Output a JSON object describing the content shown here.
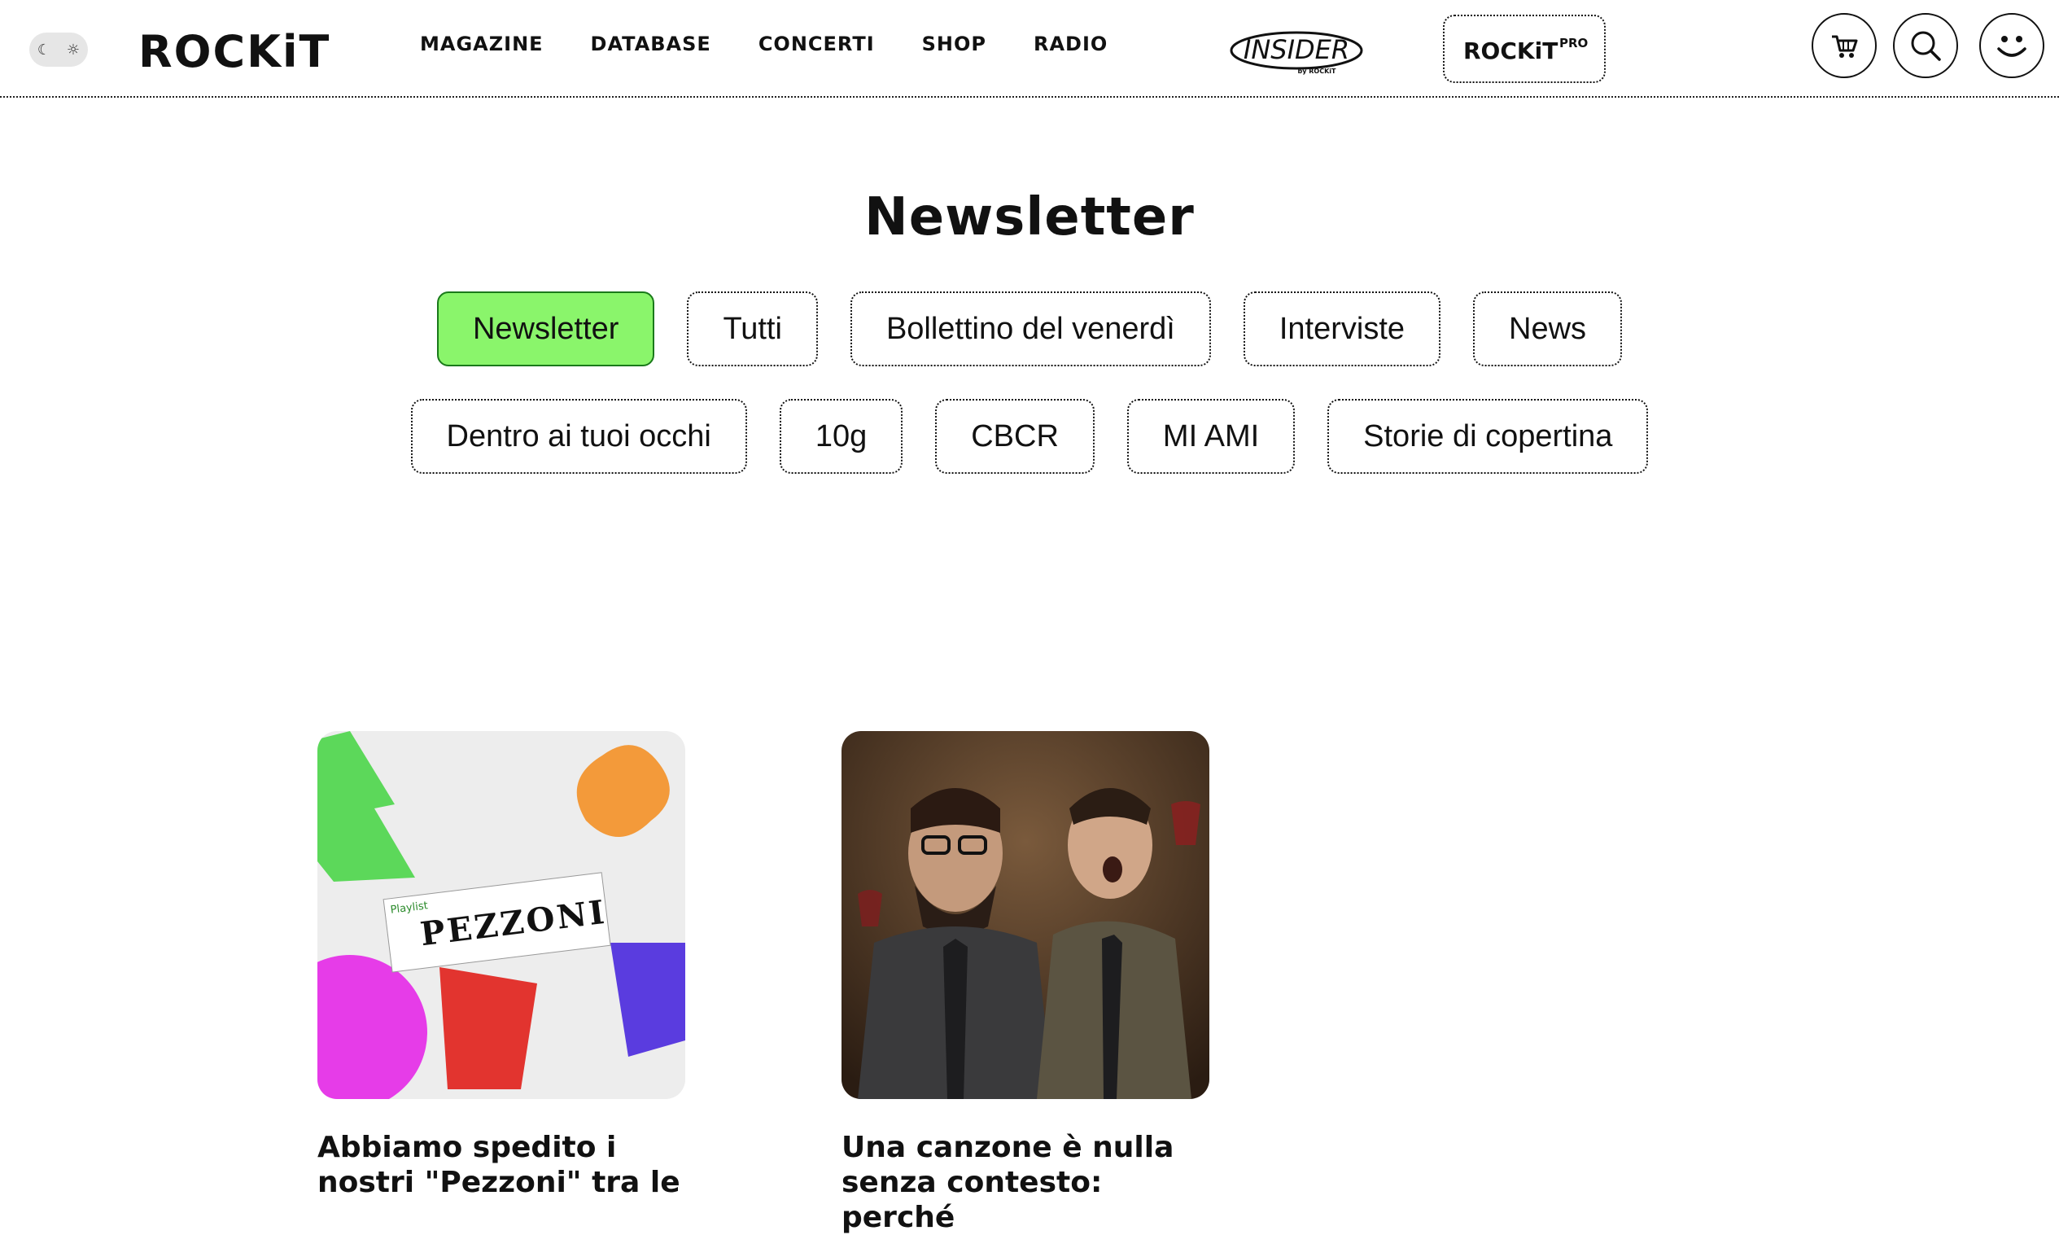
{
  "header": {
    "logo_text": "ROCKiT",
    "nav": [
      "MAGAZINE",
      "DATABASE",
      "CONCERTI",
      "SHOP",
      "RADIO"
    ],
    "insider_label": "INSIDER",
    "insider_sub": "by ROCKiT",
    "pro_logo": "ROCKiT",
    "pro_suffix": "PRO",
    "moon_icon": "☾",
    "sun_icon": "☼"
  },
  "page": {
    "title": "Newsletter"
  },
  "filters": {
    "row1": [
      "Newsletter",
      "Tutti",
      "Bollettino del venerdì",
      "Interviste",
      "News"
    ],
    "row2": [
      "Dentro ai tuoi occhi",
      "10g",
      "CBCR",
      "MI AMI",
      "Storie di copertina"
    ]
  },
  "articles": [
    {
      "title_line1": "Abbiamo spedito i",
      "title_line2": "nostri \"Pezzoni\" tra le",
      "image_text": "PEZZONI",
      "image_tag": "Playlist"
    },
    {
      "title_line1": "Una canzone è nulla",
      "title_line2": "senza contesto: perché"
    }
  ],
  "colors": {
    "active_chip": "#8af56b",
    "text": "#111111"
  }
}
